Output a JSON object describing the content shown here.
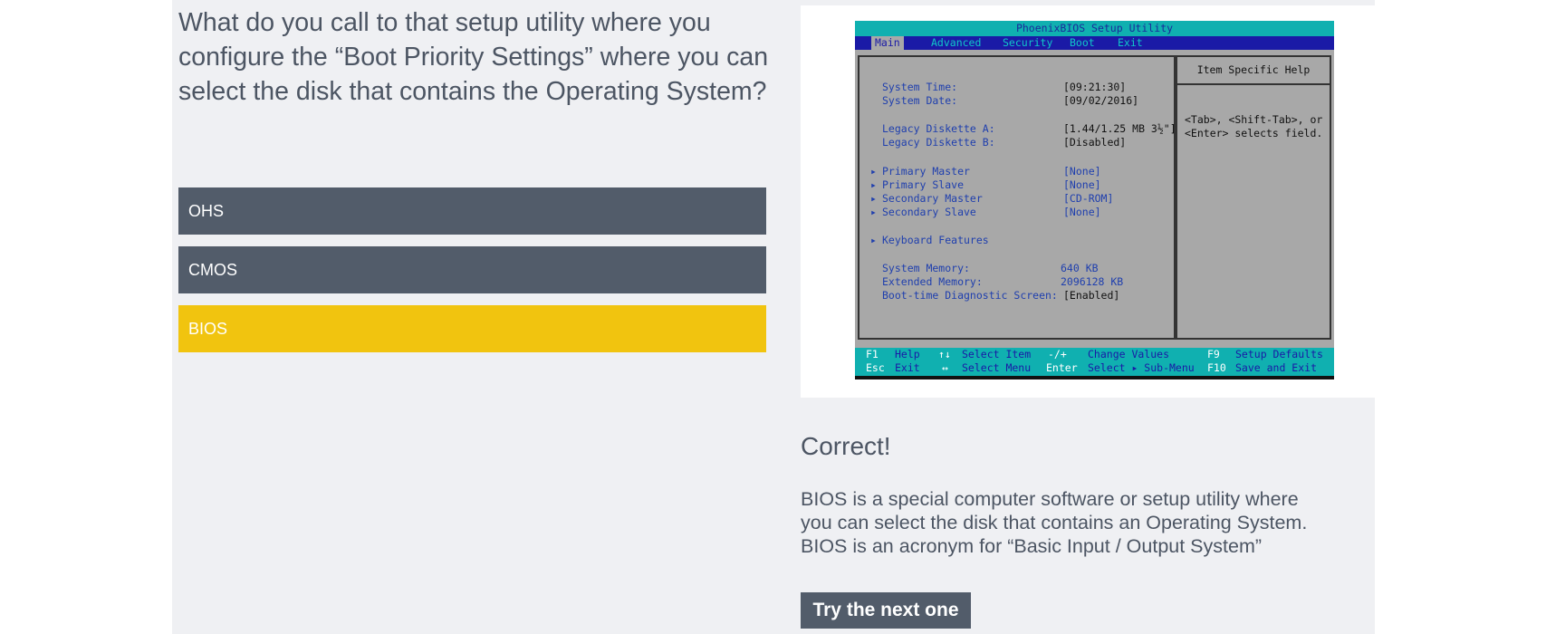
{
  "question": {
    "text": "What do you call to that setup utility where you configure the “Boot Priority Settings” where you can select the disk that contains the Operating System?"
  },
  "answers": [
    {
      "label": "OHS",
      "selected": false
    },
    {
      "label": "CMOS",
      "selected": false
    },
    {
      "label": "BIOS",
      "selected": true
    }
  ],
  "colors": {
    "panel_bg": "#eff0f3",
    "answer_bg": "#525c6a",
    "answer_selected_bg": "#f1c40f",
    "text": "#4c5563"
  },
  "bios": {
    "title": "PhoenixBIOS Setup Utility",
    "tabs": [
      "Main",
      "Advanced",
      "Security",
      "Boot",
      "Exit"
    ],
    "help_title": "Item Specific Help",
    "help_lines": [
      "<Tab>, <Shift-Tab>, or",
      "<Enter> selects field."
    ],
    "rows": [
      {
        "label": "System Time:",
        "value": "[09:21:30]"
      },
      {
        "label": "System Date:",
        "value": "[09/02/2016]"
      },
      {
        "label": "Legacy Diskette A:",
        "value": "[1.44/1.25 MB  3½\"]"
      },
      {
        "label": "Legacy Diskette B:",
        "value": "[Disabled]"
      },
      {
        "label": "Primary Master",
        "value": "[None]"
      },
      {
        "label": "Primary Slave",
        "value": "[None]"
      },
      {
        "label": "Secondary Master",
        "value": "[CD-ROM]"
      },
      {
        "label": "Secondary Slave",
        "value": "[None]"
      },
      {
        "label": "Keyboard Features",
        "value": ""
      },
      {
        "label": "System Memory:",
        "value": "640 KB"
      },
      {
        "label": "Extended Memory:",
        "value": "2096128 KB"
      },
      {
        "label": "Boot-time Diagnostic Screen:",
        "value": "[Enabled]"
      }
    ],
    "footer": {
      "f1": "F1",
      "help": "Help",
      "updown": "↑↓",
      "select_item": "Select Item",
      "minusplus": "-/+",
      "change_values": "Change Values",
      "f9": "F9",
      "setup_defaults": "Setup Defaults",
      "esc": "Esc",
      "exit": "Exit",
      "leftright": "↔",
      "select_menu": "Select Menu",
      "enter": "Enter",
      "select_submenu": "Select ▸ Sub-Menu",
      "f10": "F10",
      "save_exit": "Save and Exit"
    }
  },
  "feedback": {
    "title": "Correct!",
    "lines": [
      "BIOS is a special computer software or setup utility where",
      "you can select the disk that contains an Operating System.",
      "BIOS is an acronym for “Basic Input / Output System”"
    ]
  },
  "next_button": {
    "label": "Try the next one"
  }
}
